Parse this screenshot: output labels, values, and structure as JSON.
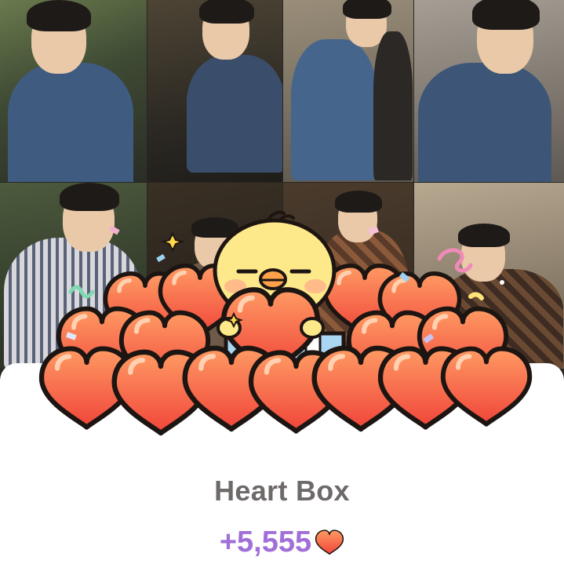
{
  "reward": {
    "title": "Heart Box",
    "amount": "+5,555"
  },
  "icons": {
    "heart": "heart-icon",
    "mascot": "chick-mascot"
  },
  "colors": {
    "amount": "#a070d8",
    "title": "#6f6a6a",
    "heart_light": "#ff8a5a",
    "heart_dark": "#f2483a",
    "mascot": "#fde88a"
  }
}
